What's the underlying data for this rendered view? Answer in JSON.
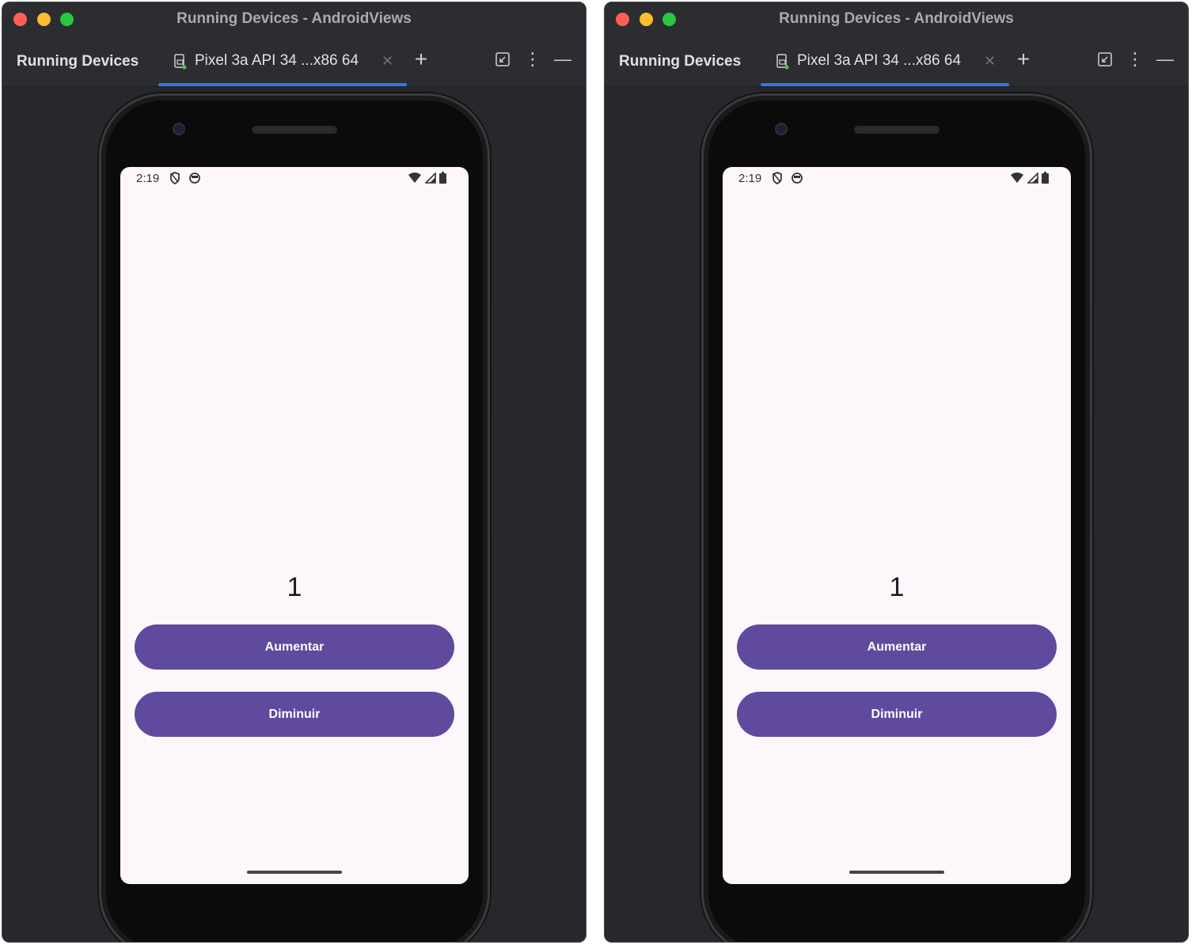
{
  "windows": [
    {
      "title": "Running Devices - AndroidViews",
      "tool_window_title": "Running Devices",
      "tab_label": "Pixel 3a API 34 ...x86 64",
      "device": {
        "status_time": "2:19",
        "counter_value": "1",
        "increase_label": "Aumentar",
        "decrease_label": "Diminuir"
      }
    },
    {
      "title": "Running Devices - AndroidViews",
      "tool_window_title": "Running Devices",
      "tab_label": "Pixel 3a API 34 ...x86 64",
      "device": {
        "status_time": "2:19",
        "counter_value": "1",
        "increase_label": "Aumentar",
        "decrease_label": "Diminuir"
      }
    }
  ],
  "icons": {
    "tab_close": "close-icon",
    "add_tab": "plus-icon",
    "restore": "restore-window-icon",
    "more": "more-options-icon",
    "minimize": "minimize-icon"
  },
  "colors": {
    "accent": "#3574f0",
    "button": "#5f4a9d",
    "screen_bg": "#fdf7fc"
  }
}
